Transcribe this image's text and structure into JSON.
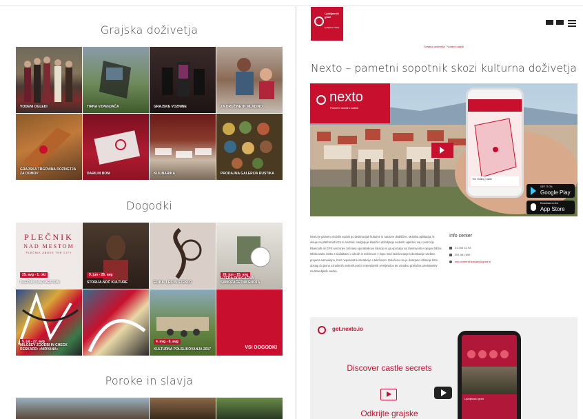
{
  "left": {
    "sections": [
      {
        "title": "Grajska doživetja"
      },
      {
        "title": "Dogodki"
      },
      {
        "title": "Poroke in slavja"
      }
    ],
    "experiences": [
      {
        "label": "VODENI OGLEDI"
      },
      {
        "label": "TIRNA VZPENJAČA"
      },
      {
        "label": "GRAJSKE VOZNINE"
      },
      {
        "label": "ZA DRUŽINE IN MLADINO"
      },
      {
        "label": "GRAJSKA TRGOVINA DOŽIVETJA ZA DOMOV"
      },
      {
        "label": "DARILNI BONI"
      },
      {
        "label": "KULINARIKA"
      },
      {
        "label": "PRODAJNA GALERIJA RUSTIKA"
      }
    ],
    "events": [
      {
        "label": "PLEČNIK NAD MESTOM",
        "date": "25. avg - 1. okt"
      },
      {
        "label": "STORIJA.NOČ KULTURE",
        "date": "9. jun - 26. avg"
      },
      {
        "label": "ELIKA, LES IN STEKLO",
        "date": ""
      },
      {
        "label": "LITERA DRUGAČNA SAMOZAČETNA ENOTA",
        "date": "26. jun - 15. avg"
      },
      {
        "label": "MILOŠEV ZGODBI IN CHECK RESKARD: »NIRVANA«",
        "date": "5. jul - 27. avg"
      },
      {
        "label": "",
        "date": ""
      },
      {
        "label": "KULTURNA POLSLIKOVANJA 2017",
        "date": "4. avg - 8. avg"
      }
    ],
    "plecnik": {
      "line1": "PLEČNIK",
      "line2": "NAD MESTOM",
      "line3": "PLEČNIK ABOVE THE CITY"
    },
    "all_events_label": "VSI DOGODKI"
  },
  "right": {
    "logo": {
      "line1": "Ljubljanski grad",
      "line2": "Ljubljana Castle"
    },
    "breadcrumb": {
      "item1": "Grajska doživetja",
      "sep": "/",
      "item2": "Vodeni ogledi"
    },
    "title": "Nexto – pametni sopotnik skozi kulturna doživetja",
    "hero": {
      "brand": "nexto",
      "tagline": "Pametni mobilni vodnik",
      "google_play_small": "GET IT ON",
      "google_play": "Google Play",
      "app_store_small": "Download on the",
      "app_store": "App Store",
      "phone_card": "The Visiting Castle"
    },
    "body": "Nexto je pametni mobilni vodnik po destinacijah kulturne in naravne dediščine. Mobilna aplikacija, ki deluje na platformah iOS in Android, nadgrajuje klasično doživljanje vodenih ogledov, saj s pomočjo Bluetooth ali GPS senzorjev zaznava uporabnikovo lokacijo in ga opozarja na zanimivosti v njegovi bližini. Obiskovalec lahko z slušalkami v ušesih in telefonom v žepu med raziskovanjem destinacije vsebine prejema samodejno, brez neposredne interakcije s telefonom. Določeno mu je dostopno izbiranje hitre dostop do jasno označenih vodenih poti in interaktivnih zemljevidov ter vizualno privlačna predstavitev multimedijskih vsebin.",
    "info": {
      "title": "Info center",
      "phone": "01 306 42 93",
      "fax": "051 681 690",
      "email": "info.center@ljubljanskigrad.si"
    },
    "promo": {
      "url": "get.nexto.io",
      "headline": "Discover castle secrets",
      "headline2": "Odkrijte grajske",
      "phone_caption": "Ljubljanski grad"
    }
  }
}
